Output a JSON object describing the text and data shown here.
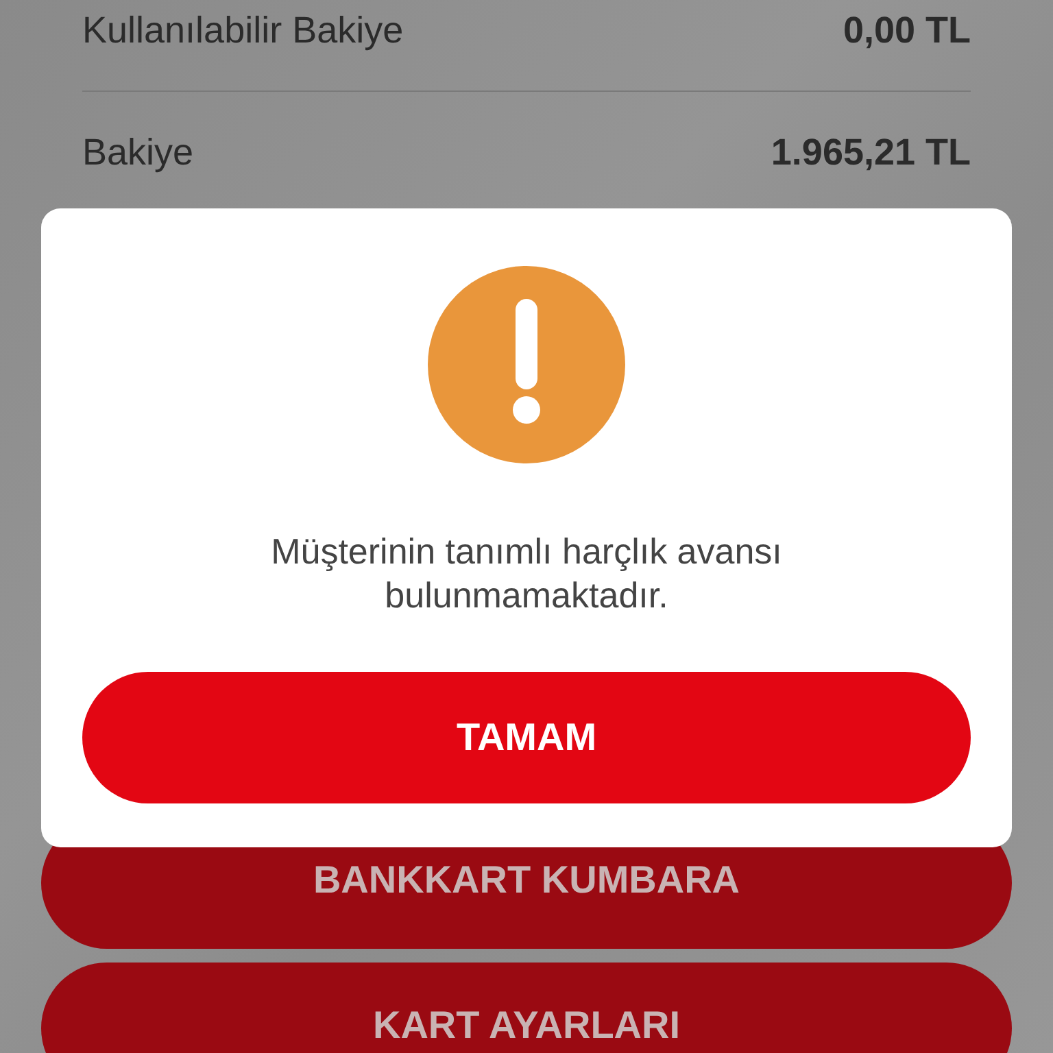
{
  "balances": [
    {
      "label": "Kullanılabilir Bakiye",
      "value": "0,00 TL"
    },
    {
      "label": "Bakiye",
      "value": "1.965,21 TL"
    }
  ],
  "buttons": [
    "BANKKART KUMBARA",
    "KART AYARLARI"
  ],
  "dialog": {
    "message": "Müşterinin tanımlı harçlık avansı bulunmamaktadır.",
    "button": "TAMAM"
  }
}
